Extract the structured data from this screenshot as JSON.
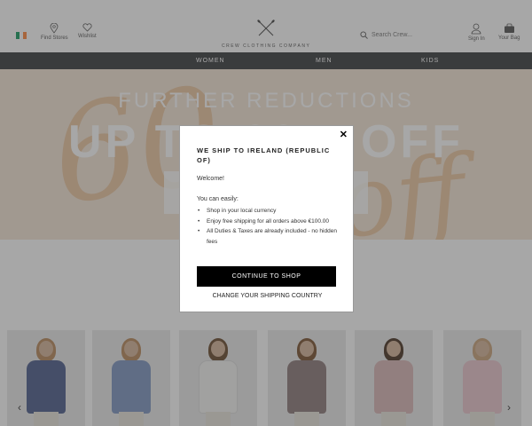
{
  "header": {
    "find_stores": "Find Stores",
    "wishlist": "Wishlist",
    "logo_text": "CREW CLOTHING COMPANY",
    "search_placeholder": "Search Crew...",
    "sign_in": "Sign In",
    "your_bag": "Your Bag"
  },
  "nav": {
    "items": [
      "WOMEN",
      "MEN",
      "KIDS"
    ]
  },
  "hero": {
    "headline": "FURTHER REDUCTIONS",
    "big_text": "UP TO 60% OFF",
    "script_text": "60",
    "script_text2": "off"
  },
  "modal": {
    "title": "WE SHIP TO IRELAND (REPUBLIC OF)",
    "welcome": "Welcome!",
    "intro": "You can easily:",
    "bullets": [
      "Shop in your local currency",
      "Enjoy free shipping for all orders above €100.00",
      "All Duties & Taxes are already included - no hidden fees"
    ],
    "cta": "CONTINUE TO SHOP",
    "change_link": "CHANGE YOUR SHIPPING COUNTRY",
    "close_icon": "close-icon"
  },
  "products": {
    "colors": [
      "#4d5e8c",
      "#7f96c2",
      "#f4f4f2",
      "#8d7b7b",
      "#d9b7b7",
      "#e9c5cd"
    ]
  },
  "colors": {
    "nav_bg": "#3a3c3f",
    "hero_bg": "#f4e5d6",
    "cta_bg": "#000000"
  }
}
